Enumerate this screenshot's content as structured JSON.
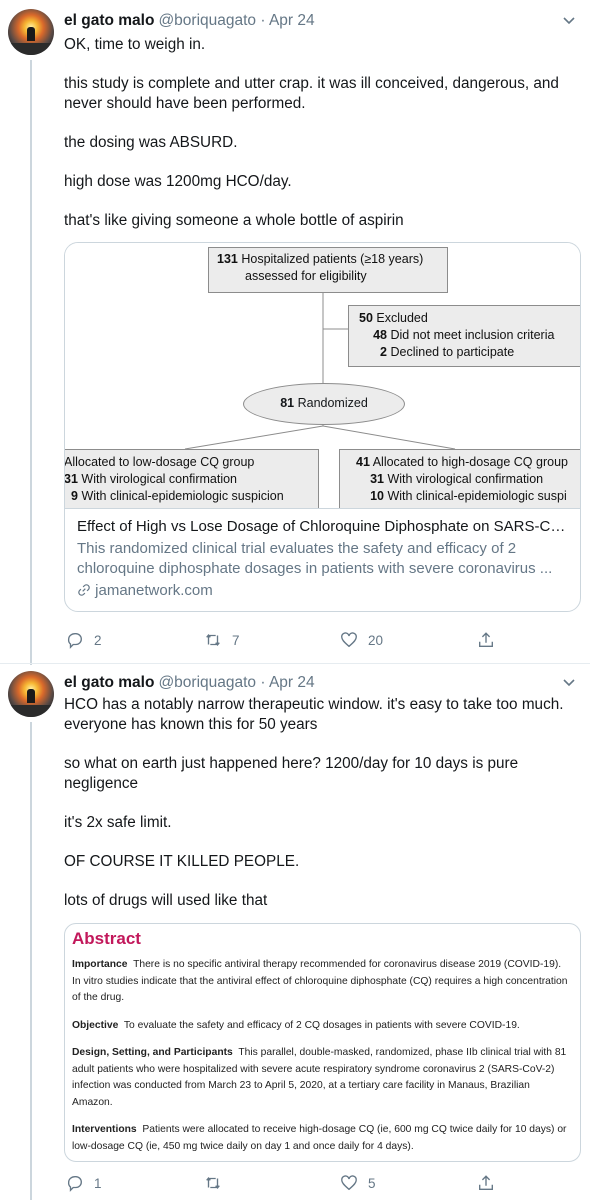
{
  "tweets": [
    {
      "author_name": "el gato malo",
      "handle": "@boriquagato · Apr 24",
      "paragraphs": [
        "OK, time to weigh in.",
        "this study is complete and utter crap.  it was ill conceived, dangerous, and never should have been performed.",
        "the dosing was ABSURD.",
        "high dose was 1200mg HCO/day.",
        "that's like giving someone a whole bottle of aspirin"
      ],
      "card": {
        "flow": {
          "top_num": "131",
          "top_line1": "Hospitalized patients (≥18 years)",
          "top_line2": "assessed for eligibility",
          "excl_num": "50",
          "excl_label": "Excluded",
          "excl_a_num": "48",
          "excl_a": "Did not meet inclusion criteria",
          "excl_b_num": "2",
          "excl_b": "Declined to participate",
          "rand_num": "81",
          "rand_label": "Randomized",
          "left_title": "Allocated to low-dosage CQ group",
          "left_a_num": "31",
          "left_a": "With virological confirmation",
          "left_b_num": "9",
          "left_b": "With clinical-epidemiologic suspicion",
          "right_num": "41",
          "right_title": "Allocated to high-dosage CQ group",
          "right_a_num": "31",
          "right_a": "With virological confirmation",
          "right_b_num": "10",
          "right_b": "With clinical-epidemiologic suspi"
        },
        "title": "Effect of High vs Lose Dosage of Chloroquine Diphosphate on SARS-Co...",
        "description": "This randomized clinical trial evaluates the safety and efficacy of 2 chloroquine diphosphate dosages in patients with severe coronavirus ...",
        "domain": "jamanetwork.com"
      },
      "reply_count": "2",
      "retweet_count": "7",
      "like_count": "20"
    },
    {
      "author_name": "el gato malo",
      "handle": "@boriquagato · Apr 24",
      "paragraphs": [
        "HCO has a notably narrow therapeutic window.  it's easy to take too much.  everyone has known this for 50 years",
        "so what on earth just happened here?  1200/day for 10 days is pure negligence",
        "it's 2x safe limit.",
        "OF COURSE IT KILLED PEOPLE.",
        "lots of drugs will used like that"
      ],
      "abstract": {
        "title": "Abstract",
        "importance_label": "Importance",
        "importance": "There is no specific antiviral therapy recommended for coronavirus disease 2019 (COVID-19). In vitro studies indicate that the antiviral effect of chloroquine diphosphate (CQ) requires a high concentration of the drug.",
        "objective_label": "Objective",
        "objective": "To evaluate the safety and efficacy of 2 CQ dosages in patients with severe COVID-19.",
        "design_label": "Design, Setting, and Participants",
        "design": "This parallel, double-masked, randomized, phase IIb clinical trial with 81 adult patients who were hospitalized with severe acute respiratory syndrome coronavirus 2 (SARS-CoV-2) infection was conducted from March 23 to April 5, 2020, at a tertiary care facility in Manaus, Brazilian Amazon.",
        "interventions_label": "Interventions",
        "interventions": "Patients were allocated to receive high-dosage CQ (ie, 600 mg CQ twice daily for 10 days) or low-dosage CQ (ie, 450 mg twice daily on day 1 and once daily for 4 days)."
      },
      "reply_count": "1",
      "retweet_count": "",
      "like_count": "5"
    }
  ],
  "colors": {
    "text": "#14171a",
    "muted": "#657786",
    "border": "#ccd6dd",
    "abstract_title": "#c2185b"
  },
  "icons": [
    "chevron-down-icon",
    "reply-icon",
    "retweet-icon",
    "like-icon",
    "share-icon",
    "link-icon"
  ]
}
